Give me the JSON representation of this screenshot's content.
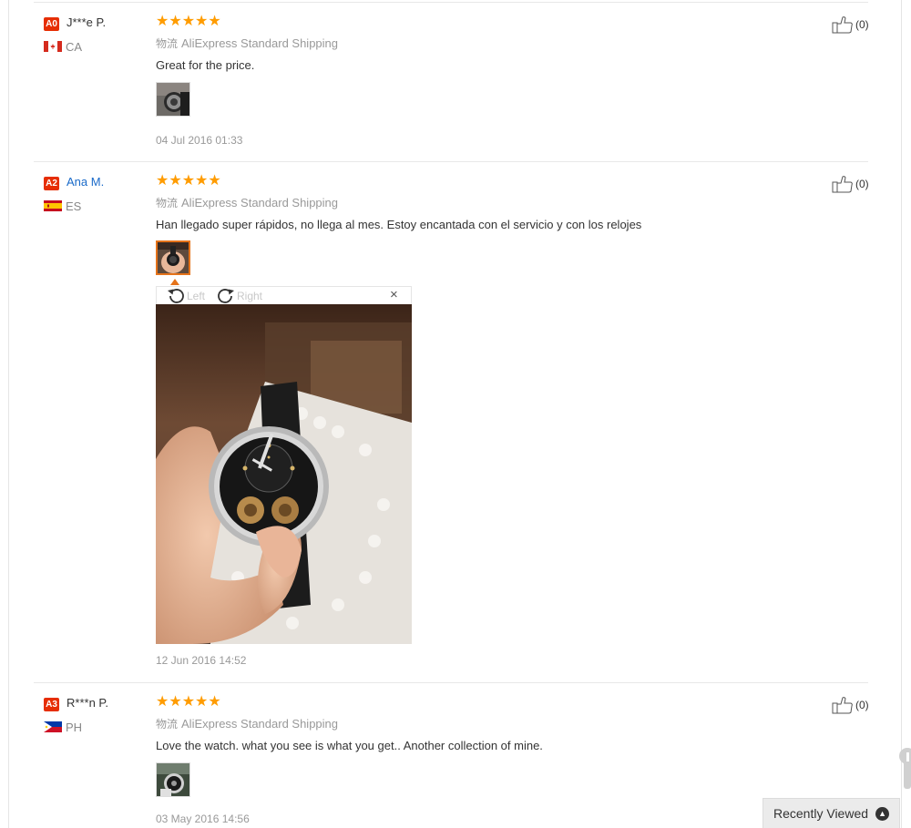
{
  "reviews": [
    {
      "level": "A0",
      "name": "J***e P.",
      "country": "CA",
      "stars": "★★★★★",
      "shipping_label": "物流",
      "shipping": "AliExpress Standard Shipping",
      "text": "Great for the price.",
      "date": "04 Jul 2016 01:33",
      "useful_count": "(0)"
    },
    {
      "level": "A2",
      "name": "Ana M.",
      "country": "ES",
      "stars": "★★★★★",
      "shipping_label": "物流",
      "shipping": "AliExpress Standard Shipping",
      "text": "Han llegado super rápidos, no llega al mes. Estoy encantada con el servicio y con los relojes",
      "date": "12 Jun 2016 14:52",
      "useful_count": "(0)"
    },
    {
      "level": "A3",
      "name": "R***n P.",
      "country": "PH",
      "stars": "★★★★★",
      "shipping_label": "物流",
      "shipping": "AliExpress Standard Shipping",
      "text": "Love the watch. what you see is what you get.. Another collection of mine.",
      "date": "03 May 2016 14:56",
      "useful_count": "(0)"
    }
  ],
  "viewer": {
    "rotate_left": "Left",
    "rotate_right": "Right",
    "close": "×"
  },
  "recently_viewed": {
    "label": "Recently Viewed"
  },
  "colors": {
    "star": "#ff9c00",
    "level_badge": "#e62e04",
    "link": "#1a6ac9",
    "active_thumb_border": "#e5731a"
  }
}
